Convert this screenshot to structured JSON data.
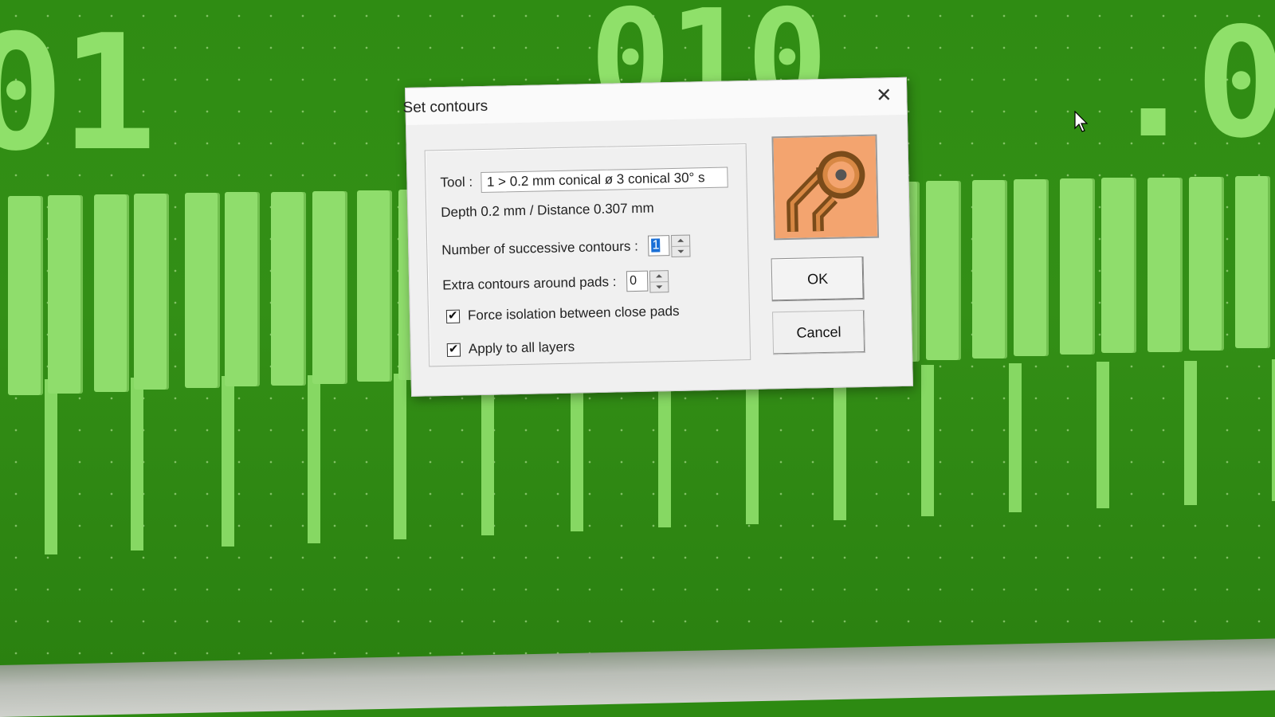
{
  "background": {
    "labels": [
      "01",
      "010",
      ".0"
    ]
  },
  "dialog": {
    "title": "Set contours",
    "tool_label": "Tool :",
    "tool_value": "1 > 0.2  mm conical    ø 3    conical 30°    s",
    "depth_line": "Depth 0.2 mm  /  Distance 0.307 mm",
    "contours_label": "Number of successive contours :",
    "contours_value": "1",
    "extra_label": "Extra contours around pads :",
    "extra_value": "0",
    "force_isolation_label": "Force isolation between close pads",
    "force_isolation_checked": true,
    "apply_all_label": "Apply to all layers",
    "apply_all_checked": true,
    "ok_label": "OK",
    "cancel_label": "Cancel",
    "icon": "pcb-contour-icon"
  },
  "colors": {
    "pcb_background": "#2d8a12",
    "pcb_copper": "#8fdd6c",
    "icon_fill": "#f3a46f",
    "icon_trace": "#7a4b1a"
  }
}
